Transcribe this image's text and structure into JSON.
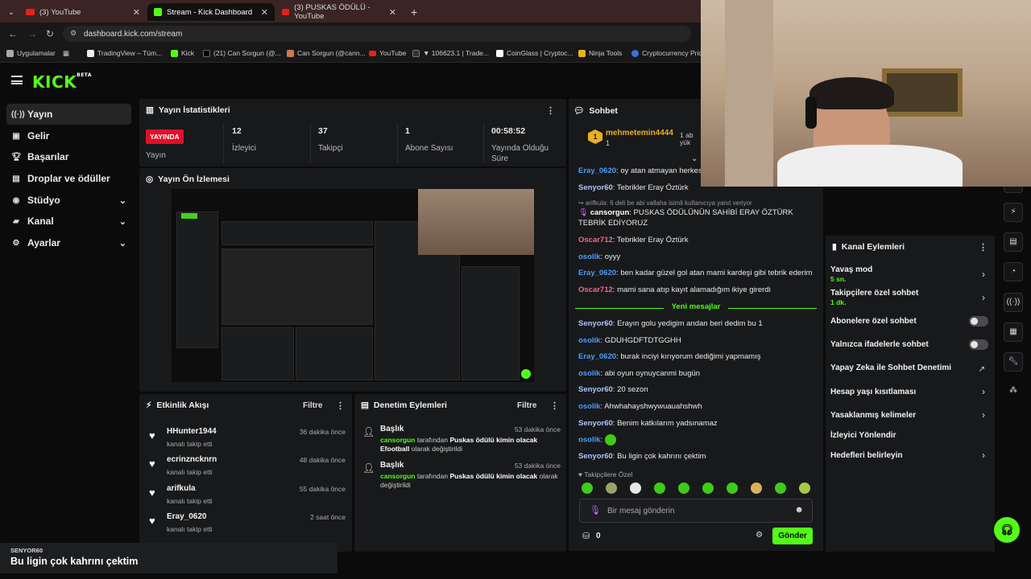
{
  "browser": {
    "tabs": [
      {
        "label": "(3) YouTube",
        "icon": "youtube-icon",
        "active": false
      },
      {
        "label": "Stream - Kick Dashboard",
        "icon": "kick-icon",
        "active": true
      },
      {
        "label": "(3) PUSKAS ÖDÜLÜ - YouTube",
        "icon": "youtube-icon",
        "active": false
      }
    ],
    "new_tab": "+",
    "url": "dashboard.kick.com/stream",
    "bookmarks": [
      "Uygulamalar",
      "TradingView – Tüm...",
      "Kick",
      "(21) Can Sorgun (@...",
      "Can Sorgun (@cann...",
      "YouTube",
      "▼ 106623.1 | Trade...",
      "CoinGlass | Cryptoc...",
      "Ninja Tools",
      "Cryptocurrency Pric..."
    ]
  },
  "brand": {
    "logo": "KICK",
    "badge": "BETA",
    "accent": "#53fc18"
  },
  "sidebar": {
    "items": [
      {
        "label": "Yayın",
        "icon": "broadcast-icon",
        "selected": true
      },
      {
        "label": "Gelir",
        "icon": "revenue-icon"
      },
      {
        "label": "Başarılar",
        "icon": "trophy-icon"
      },
      {
        "label": "Droplar ve ödüller",
        "icon": "gift-icon"
      },
      {
        "label": "Stüdyo",
        "icon": "studio-icon",
        "expandable": true
      },
      {
        "label": "Kanal",
        "icon": "channel-icon",
        "expandable": true
      },
      {
        "label": "Ayarlar",
        "icon": "gear-icon",
        "expandable": true
      }
    ]
  },
  "stats": {
    "title": "Yayın İstatistikleri",
    "live_badge": "YAYINDA",
    "live_label": "Yayın",
    "items": [
      {
        "value": "12",
        "label": "İzleyici"
      },
      {
        "value": "37",
        "label": "Takipçi"
      },
      {
        "value": "1",
        "label": "Abone Sayısı"
      },
      {
        "value": "00:58:52",
        "label": "Yayında Olduğu Süre"
      }
    ]
  },
  "preview": {
    "title": "Yayın Ön İzlemesi"
  },
  "activity": {
    "title": "Etkinlik Akışı",
    "filter": "Filtre",
    "items": [
      {
        "name": "HHunter1944",
        "action": "kanalı takip etti",
        "time": "36 dakika önce"
      },
      {
        "name": "ecrinzncknrn",
        "action": "kanalı takip etti",
        "time": "48 dakika önce"
      },
      {
        "name": "arifkula",
        "action": "kanalı takip etti",
        "time": "55 dakika önce"
      },
      {
        "name": "Eray_0620",
        "action": "kanalı takip etti",
        "time": "2 saat önce"
      }
    ]
  },
  "moderation": {
    "title": "Denetim Eylemleri",
    "filter": "Filtre",
    "items": [
      {
        "title": "Başlık",
        "time": "53 dakika önce",
        "user": "cansorgun",
        "by": "tarafından",
        "value": "Puskas ödülü kimin olacak Efootball",
        "suffix": "olarak değiştirildi"
      },
      {
        "title": "Başlık",
        "time": "53 dakika önce",
        "user": "cansorgun",
        "by": "tarafından",
        "value": "Puskas ödülü kimin olacak",
        "suffix": "olarak değiştirildi"
      }
    ]
  },
  "chat": {
    "title": "Sohbet",
    "pinned_user": "mehmetemin4444",
    "pinned_count": "1",
    "pinned_extra": "1 ab yük",
    "reply_hint": "↪ arifkula: 6 deli be abi vallaha isimli kullanıcıya yanıt veriyor",
    "messages_before": [
      {
        "user": "Eray_0620",
        "text": "oy atan atmayan herkese"
      },
      {
        "user": "Senyor60",
        "text": "Tebrikler Eray Öztürk"
      }
    ],
    "messages_mid": [
      {
        "user": "cansorgun",
        "text": "PUSKAS ÖDÜLÜNÜN SAHİBİ ERAY ÖZTÜRK TEBRİK EDİYORUZ"
      },
      {
        "user": "Oscar712",
        "text": "Tebrikler Eray Öztürk"
      },
      {
        "user": "osolik",
        "text": "oyyy"
      },
      {
        "user": "Eray_0620",
        "text": "ben kadar güzel gol atan mami kardeşi gibi tebrik ederim"
      },
      {
        "user": "Oscar712",
        "text": "mami sana atıp kayıt alamadığım ikiye girerdi"
      }
    ],
    "new_messages": "Yeni mesajlar",
    "messages_after": [
      {
        "user": "Senyor60",
        "text": "Erayın golu yedigim andan beri dedim bu 1"
      },
      {
        "user": "osolik",
        "text": "GDUHGDFTDTGGHH"
      },
      {
        "user": "Eray_0620",
        "text": "burak inciyi kırıyorum dediğimi yapmamış"
      },
      {
        "user": "osolik",
        "text": "abi oyun oynuycanmi bugün"
      },
      {
        "user": "Senyor60",
        "text": "20 sezon"
      },
      {
        "user": "osolik",
        "text": "Ahwhahayshwywuauahshwh"
      },
      {
        "user": "Senyor60",
        "text": "Benim katkılarım yadsınamaz"
      },
      {
        "user": "osolik",
        "text": ""
      },
      {
        "user": "Senyor60",
        "text": "Bu ligin çok kahrını çektim"
      }
    ],
    "follower_only": "Takipçilere Özel",
    "input_placeholder": "Bir mesaj gönderin",
    "points": "0",
    "send": "Gönder"
  },
  "channel_actions": {
    "title": "Kanal Eylemleri",
    "items": [
      {
        "label": "Yavaş mod",
        "sub": "5 sn.",
        "control": "arrow"
      },
      {
        "label": "Takipçilere özel sohbet",
        "sub": "1 dk.",
        "control": "arrow"
      },
      {
        "label": "Abonelere özel sohbet",
        "sub": "",
        "control": "toggle"
      },
      {
        "label": "Yalnızca ifadelerle sohbet",
        "sub": "",
        "control": "toggle"
      },
      {
        "label": "Yapay Zeka ile Sohbet Denetimi",
        "sub": "",
        "control": "external"
      },
      {
        "label": "Hesap yaşı kısıtlaması",
        "sub": "",
        "control": "arrow"
      },
      {
        "label": "Yasaklanmış kelimeler",
        "sub": "",
        "control": "arrow"
      },
      {
        "label": "İzleyici Yönlendir",
        "sub": "",
        "control": "none"
      },
      {
        "label": "Hedefleri belirleyin",
        "sub": "",
        "control": "arrow"
      }
    ]
  },
  "rail_icons": [
    "bolt-icon",
    "document-icon",
    "chat-icon",
    "broadcast-icon",
    "layout-icon",
    "wrench-icon",
    "effects-icon"
  ],
  "toast": {
    "user": "SENYOR60",
    "text": "Bu ligin çok kahrını çektim"
  }
}
